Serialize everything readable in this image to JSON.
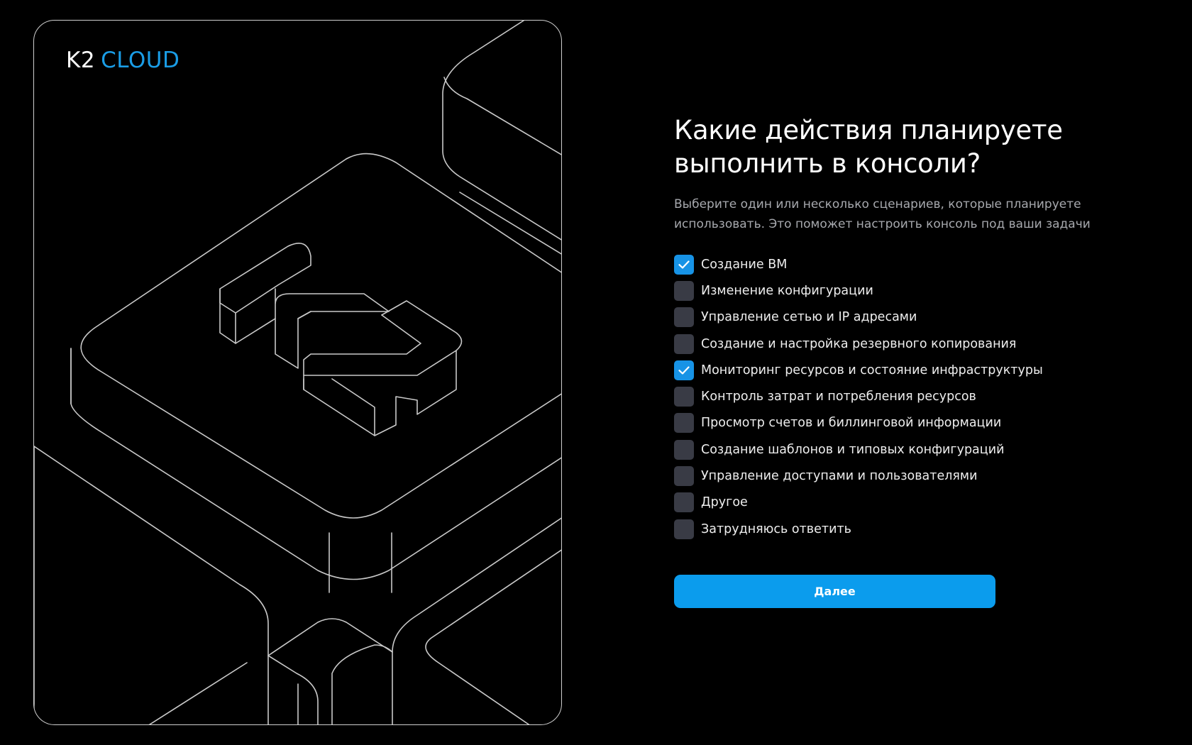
{
  "brand": {
    "logo_part1": "K2",
    "logo_part2": "CLOUD",
    "accent_color": "#1a9de6"
  },
  "form": {
    "title_line1": "Какие действия планируете",
    "title_line2": "выполнить в консоли?",
    "subtitle_line1": "Выберите один или несколько сценариев, которые планируете",
    "subtitle_line2": "использовать. Это поможет настроить консоль под ваши задачи",
    "options": [
      {
        "label": "Создание ВМ",
        "checked": true
      },
      {
        "label": "Изменение конфигурации",
        "checked": false
      },
      {
        "label": "Управление сетью и IP адресами",
        "checked": false
      },
      {
        "label": "Создание и настройка резервного копирования",
        "checked": false
      },
      {
        "label": "Мониторинг ресурсов и состояние инфраструктуры",
        "checked": true
      },
      {
        "label": "Контроль затрат и потребления ресурсов",
        "checked": false
      },
      {
        "label": "Просмотр счетов и биллинговой информации",
        "checked": false
      },
      {
        "label": "Создание шаблонов и типовых конфигураций",
        "checked": false
      },
      {
        "label": "Управление доступами и пользователями",
        "checked": false
      },
      {
        "label": "Другое",
        "checked": false
      },
      {
        "label": "Затрудняюсь ответить",
        "checked": false
      }
    ],
    "next_label": "Далее",
    "button_color": "#0b9ced",
    "checkbox_checked_color": "#1793e6",
    "checkbox_unchecked_color": "#393b45"
  }
}
